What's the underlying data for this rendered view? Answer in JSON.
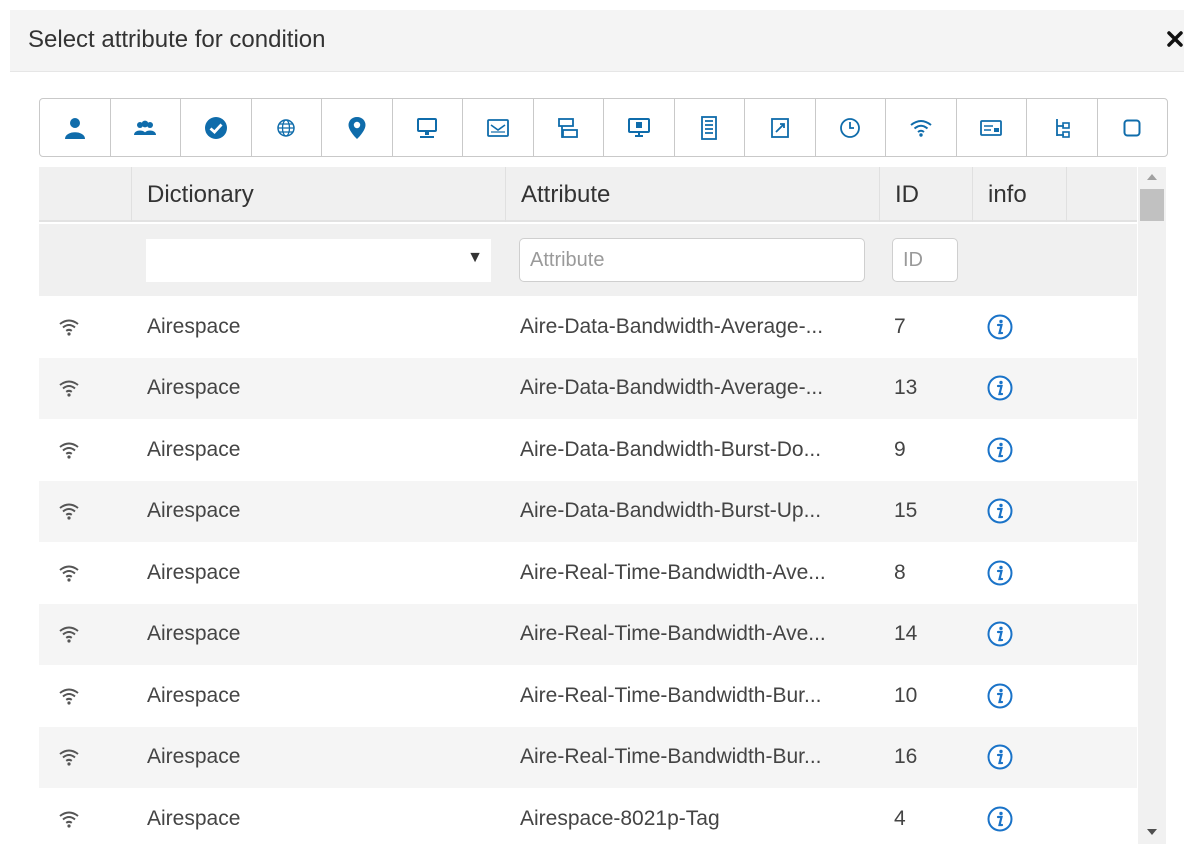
{
  "dialog": {
    "title": "Select attribute for condition",
    "close_icon": "close-icon"
  },
  "toolbar": {
    "icons": [
      "user-icon",
      "users-icon",
      "check-circle-icon",
      "globe-icon",
      "location-pin-icon",
      "computer-icon",
      "mail-icon",
      "network-icon",
      "monitor-icon",
      "building-icon",
      "document-icon",
      "clock-icon",
      "wifi-icon",
      "card-icon",
      "hierarchy-icon",
      "square-icon"
    ],
    "accent_color": "#0f6cab"
  },
  "table": {
    "columns": [
      "Dictionary",
      "Attribute",
      "ID",
      "info"
    ],
    "filters": {
      "dictionary_value": "",
      "attribute_placeholder": "Attribute",
      "id_placeholder": "ID"
    },
    "rows": [
      {
        "icon": "wifi-icon",
        "dictionary": "Airespace",
        "attribute": "Aire-Data-Bandwidth-Average-...",
        "id": "7"
      },
      {
        "icon": "wifi-icon",
        "dictionary": "Airespace",
        "attribute": "Aire-Data-Bandwidth-Average-...",
        "id": "13"
      },
      {
        "icon": "wifi-icon",
        "dictionary": "Airespace",
        "attribute": "Aire-Data-Bandwidth-Burst-Do...",
        "id": "9"
      },
      {
        "icon": "wifi-icon",
        "dictionary": "Airespace",
        "attribute": "Aire-Data-Bandwidth-Burst-Up...",
        "id": "15"
      },
      {
        "icon": "wifi-icon",
        "dictionary": "Airespace",
        "attribute": "Aire-Real-Time-Bandwidth-Ave...",
        "id": "8"
      },
      {
        "icon": "wifi-icon",
        "dictionary": "Airespace",
        "attribute": "Aire-Real-Time-Bandwidth-Ave...",
        "id": "14"
      },
      {
        "icon": "wifi-icon",
        "dictionary": "Airespace",
        "attribute": "Aire-Real-Time-Bandwidth-Bur...",
        "id": "10"
      },
      {
        "icon": "wifi-icon",
        "dictionary": "Airespace",
        "attribute": "Aire-Real-Time-Bandwidth-Bur...",
        "id": "16"
      },
      {
        "icon": "wifi-icon",
        "dictionary": "Airespace",
        "attribute": "Airespace-8021p-Tag",
        "id": "4"
      }
    ],
    "info_icon": "info-icon",
    "info_color": "#1a73c8"
  }
}
